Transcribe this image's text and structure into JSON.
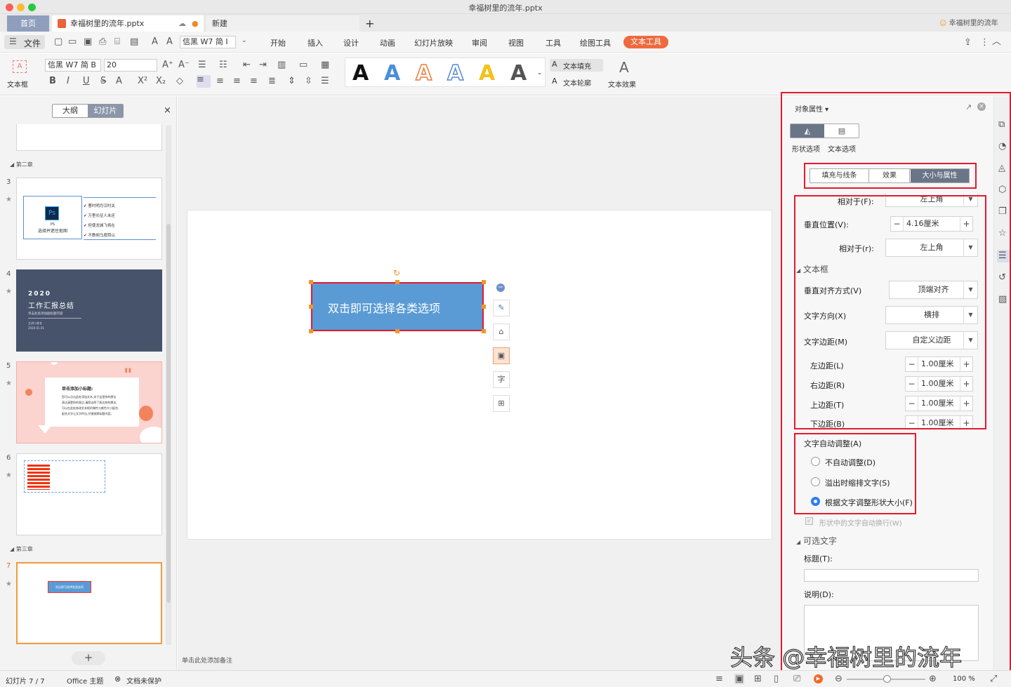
{
  "window": {
    "title": "幸福树里的流年.pptx"
  },
  "tabs": {
    "home": "首页",
    "file": "幸福树里的流年.pptx",
    "new": "新建",
    "plus": "+",
    "user": "幸福树里的流年"
  },
  "menu": {
    "file": "文件",
    "font": "信黑 W7 简 I",
    "items": [
      "开始",
      "插入",
      "设计",
      "动画",
      "幻灯片放映",
      "审阅",
      "视图",
      "工具",
      "绘图工具",
      "文本工具"
    ]
  },
  "ribbon": {
    "textbox": "文本框",
    "font": "信黑 W7 简 B",
    "size": "20",
    "text_fill": "文本填充",
    "text_outline": "文本轮廓",
    "text_effect": "文本效果",
    "letters": [
      "A",
      "A",
      "A",
      "A",
      "A",
      "A"
    ]
  },
  "left": {
    "tab_outline": "大纲",
    "tab_slides": "幻灯片",
    "close": "×",
    "section2": "第二章",
    "section3": "第三章",
    "add": "+",
    "slides": [
      {
        "num": "3"
      },
      {
        "num": "4"
      },
      {
        "num": "5"
      },
      {
        "num": "6"
      },
      {
        "num": "7"
      }
    ],
    "s3": {
      "ps": "Ps",
      "ps_label": "PS",
      "ps_sub": "选择并遮住抠图",
      "items": [
        "✔ 曹时明月汉时关",
        "✔ 万里长征人未还",
        "✔ 但使龙城飞将在",
        "✔ 不教胡马度阴山"
      ]
    },
    "s4": {
      "year": "2020",
      "title": "工作汇报总结",
      "sub": "单击此处添加副标题内容",
      "author": "主讲人姓名",
      "date": "2020.01.01"
    },
    "s5": {
      "title": "单击添加小标题:",
      "body": [
        "您可以点击此处添加文本,关于这里你的想法",
        "表达清楚你的观点,请简洁明了表达你的想法,",
        "可以在此处修改文本框的属性与颜色大小配合,",
        "配合文字让文字传达,仔细观察标题内容。"
      ],
      "quote": "\""
    },
    "s7": {
      "box": "双击即可选择各类选项"
    }
  },
  "slide": {
    "box_text": "双击即可选择各类选项",
    "notes": "单击此处添加备注"
  },
  "panel": {
    "title": "对象属性",
    "shape_tab": "形状选项",
    "text_tab": "文本选项",
    "sub_tabs": [
      "填充与线条",
      "效果",
      "大小与属性"
    ],
    "relative_to_f": "相对于(F):",
    "rel_f_val": "左上角",
    "vpos": "垂直位置(V):",
    "vpos_val": "4.16厘米",
    "relative_to_r": "相对于(r):",
    "rel_r_val": "左上角",
    "textbox_section": "文本框",
    "valign": "垂直对齐方式(V)",
    "valign_val": "顶端对齐",
    "direction": "文字方向(X)",
    "direction_val": "横排",
    "margin": "文字边距(M)",
    "margin_val": "自定义边距",
    "left_m": "左边距(L)",
    "right_m": "右边距(R)",
    "top_m": "上边距(T)",
    "bottom_m": "下边距(B)",
    "m_val": "1.00厘米",
    "autofit": "文字自动调整(A)",
    "no_auto": "不自动调整(D)",
    "shrink": "溢出时缩排文字(S)",
    "resize": "根据文字调整形状大小(F)",
    "wrap": "形状中的文字自动换行(W)",
    "alt_section": "可选文字",
    "alt_title": "标题(T):",
    "alt_desc": "说明(D):"
  },
  "status": {
    "slide": "幻灯片 7 / 7",
    "theme": "Office 主题",
    "protect": "文档未保护",
    "zoom": "100 %"
  },
  "watermark": "头条 @幸福树里的流年"
}
